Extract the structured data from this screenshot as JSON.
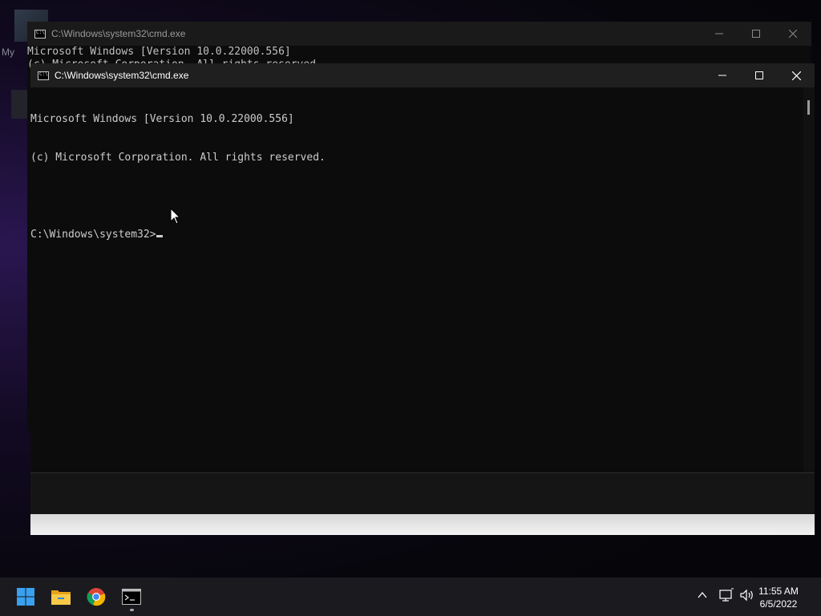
{
  "desktop": {
    "icon_label": "My"
  },
  "background_window": {
    "title": "C:\\Windows\\system32\\cmd.exe",
    "console_line_1": "Microsoft Windows [Version 10.0.22000.556]",
    "console_line_2": "(c) Microsoft Corporation. All rights reserved."
  },
  "front_window": {
    "title": "C:\\Windows\\system32\\cmd.exe",
    "console_lines": [
      "Microsoft Windows [Version 10.0.22000.556]",
      "(c) Microsoft Corporation. All rights reserved.",
      "",
      "C:\\Windows\\system32>"
    ]
  },
  "controls": {
    "minimize_icon": "minimize-icon",
    "maximize_icon": "maximize-icon",
    "close_icon": "close-icon"
  },
  "taskbar": {
    "items": [
      "start-icon",
      "file-explorer-icon",
      "chrome-icon",
      "command-prompt-icon"
    ],
    "tray": [
      "chevron-up-icon",
      "network-icon",
      "volume-icon"
    ],
    "time": "11:55 AM",
    "date": "6/5/2022"
  },
  "colors": {
    "console_bg": "#0c0c0c",
    "console_text": "#cccccc",
    "titlebar": "#1f1f1f",
    "taskbar": "#1a1a1f"
  }
}
